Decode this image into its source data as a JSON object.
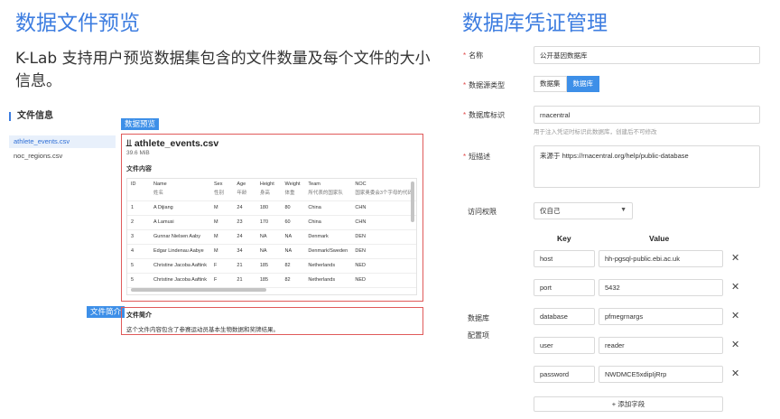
{
  "left": {
    "title": "数据文件预览",
    "description": "K-Lab 支持用户预览数据集包含的文件数量及每个文件的大小信息。",
    "file_info_heading": "文件信息",
    "files": [
      "athlete_events.csv",
      "noc_regions.csv"
    ],
    "preview_tag": "数据预览",
    "summary_tag": "文件简介",
    "preview": {
      "filename": "athlete_events.csv",
      "file_icon": "csv-file-icon",
      "size": "39.6 MiB",
      "content_label": "文件内容",
      "columns": [
        {
          "name": "ID",
          "sub": ""
        },
        {
          "name": "Name",
          "sub": "姓名"
        },
        {
          "name": "Sex",
          "sub": "性别"
        },
        {
          "name": "Age",
          "sub": "年龄"
        },
        {
          "name": "Height",
          "sub": "身高"
        },
        {
          "name": "Weight",
          "sub": "体重"
        },
        {
          "name": "Team",
          "sub": "所代表的国家队"
        },
        {
          "name": "NOC",
          "sub": "国家奥委会3个字母的代码"
        }
      ],
      "rows": [
        [
          "1",
          "A Dijiang",
          "M",
          "24",
          "180",
          "80",
          "China",
          "CHN"
        ],
        [
          "2",
          "A Lamusi",
          "M",
          "23",
          "170",
          "60",
          "China",
          "CHN"
        ],
        [
          "3",
          "Gunnar Nielsen Aaby",
          "M",
          "24",
          "NA",
          "NA",
          "Denmark",
          "DEN"
        ],
        [
          "4",
          "Edgar Lindenau Aabye",
          "M",
          "34",
          "NA",
          "NA",
          "Denmark/Sweden",
          "DEN"
        ],
        [
          "5",
          "Christine Jacoba Aaftink",
          "F",
          "21",
          "185",
          "82",
          "Netherlands",
          "NED"
        ],
        [
          "5",
          "Christine Jacoba Aaftink",
          "F",
          "21",
          "185",
          "82",
          "Netherlands",
          "NED"
        ]
      ]
    },
    "summary": {
      "label": "文件简介",
      "text": "这个文件内容包含了参赛运动员基本生物数据和奖牌结果。"
    }
  },
  "right": {
    "title": "数据库凭证管理",
    "name_label": "名称",
    "name_value": "公开基因数据库",
    "source_type_label": "数据源类型",
    "source_types": [
      "数据集",
      "数据库"
    ],
    "selected_source_type": "数据库",
    "db_id_label": "数据库标识",
    "db_id_value": "rnacentral",
    "db_id_hint": "用于注入凭证时标识此数据库，创建后不可修改",
    "desc_label": "短描述",
    "desc_value": "来源于 https://rnacentral.org/help/public-database",
    "access_label": "访问权限",
    "access_value": "仅自己",
    "config_label_1": "数据库",
    "config_label_2": "配置项",
    "key_header": "Key",
    "value_header": "Value",
    "config": [
      {
        "key": "host",
        "value": "hh-pgsql-public.ebi.ac.uk"
      },
      {
        "key": "port",
        "value": "5432"
      },
      {
        "key": "database",
        "value": "pfmegrnargs"
      },
      {
        "key": "user",
        "value": "reader"
      },
      {
        "key": "password",
        "value": "NWDMCE5xdipIjRrp"
      }
    ],
    "delete_symbol": "✕",
    "add_field": "+ 添加字段",
    "required_mark": "*"
  }
}
